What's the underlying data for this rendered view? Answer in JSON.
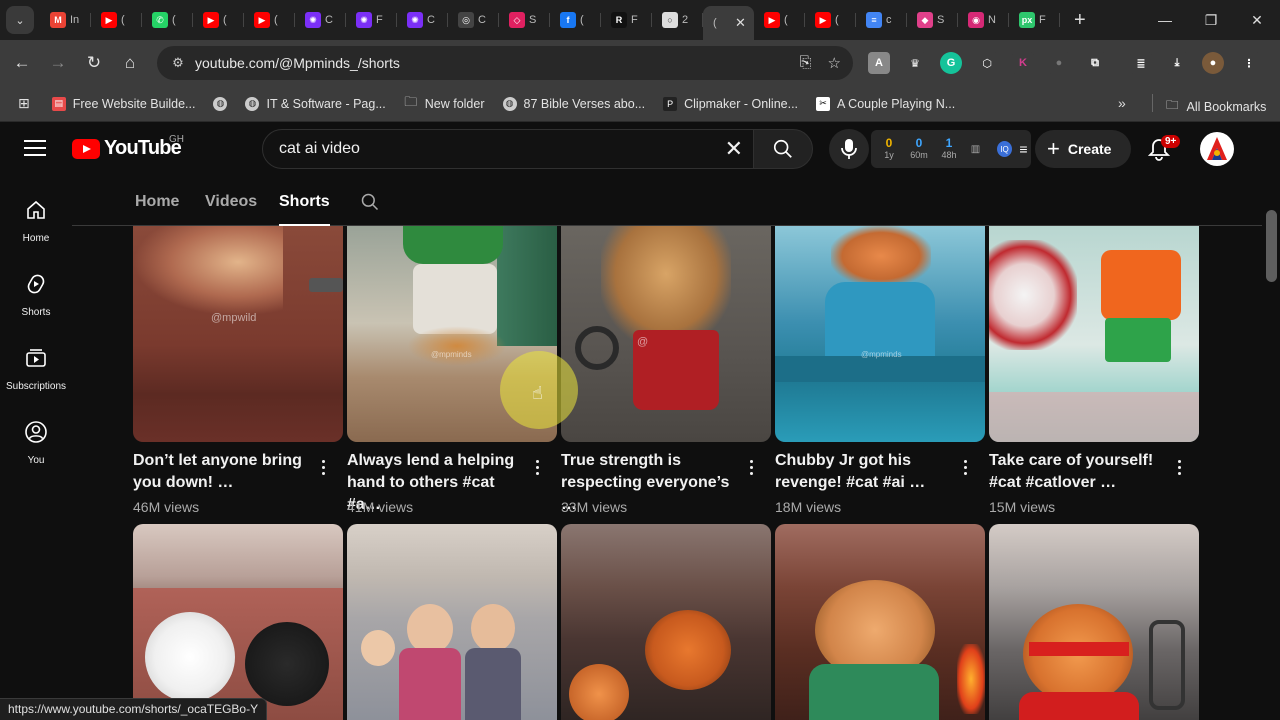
{
  "browser": {
    "tabs": [
      {
        "icon": "tab-list-icon",
        "title": ""
      },
      {
        "icon": "gmail-icon",
        "title": "In",
        "color": "#ea4335",
        "glyph": "M"
      },
      {
        "icon": "youtube-icon",
        "title": "(",
        "color": "#ff0000",
        "glyph": "▶"
      },
      {
        "icon": "whatsapp-icon",
        "title": "(",
        "color": "#25d366",
        "glyph": "✆"
      },
      {
        "icon": "youtube-icon",
        "title": "(",
        "color": "#ff0000",
        "glyph": "▶"
      },
      {
        "icon": "youtube-icon",
        "title": "(",
        "color": "#ff0000",
        "glyph": "▶"
      },
      {
        "icon": "purple-gear-icon",
        "title": "C",
        "color": "#7b2ff7",
        "glyph": "✺"
      },
      {
        "icon": "purple-gear-icon",
        "title": "F",
        "color": "#7b2ff7",
        "glyph": "✺"
      },
      {
        "icon": "purple-gear-icon",
        "title": "C",
        "color": "#7b2ff7",
        "glyph": "✺"
      },
      {
        "icon": "openai-icon",
        "title": "C",
        "color": "#444444",
        "glyph": "◎"
      },
      {
        "icon": "shortcut-icon",
        "title": "S",
        "color": "#e02060",
        "glyph": "◇"
      },
      {
        "icon": "facebook-icon",
        "title": "(",
        "color": "#1877f2",
        "glyph": "f"
      },
      {
        "icon": "r-icon",
        "title": "F",
        "color": "#111111",
        "glyph": "R"
      },
      {
        "icon": "circle-icon",
        "title": "2",
        "color": "#dddddd",
        "glyph": "○"
      },
      {
        "icon": "active-tab",
        "title": "(",
        "color": "#3c3c3c",
        "glyph": ""
      },
      {
        "icon": "youtube-icon",
        "title": "(",
        "color": "#ff0000",
        "glyph": "▶"
      },
      {
        "icon": "youtube-icon",
        "title": "(",
        "color": "#ff0000",
        "glyph": "▶"
      },
      {
        "icon": "docs-icon",
        "title": "c",
        "color": "#4285f4",
        "glyph": "≡"
      },
      {
        "icon": "photo-icon",
        "title": "S",
        "color": "#e0408a",
        "glyph": "◆"
      },
      {
        "icon": "instagram-icon",
        "title": "N",
        "color": "#d62976",
        "glyph": "◉"
      },
      {
        "icon": "pixabay-icon",
        "title": "F",
        "color": "#2ec66d",
        "glyph": "px"
      }
    ],
    "url": "youtube.com/@Mpminds_/shorts",
    "bookmarks": [
      {
        "label": "Free Website Builde...",
        "icon": "page-icon"
      },
      {
        "label": "",
        "icon": "globe-icon"
      },
      {
        "label": "IT & Software - Pag...",
        "icon": "globe-icon"
      },
      {
        "label": "New folder",
        "icon": "folder-icon"
      },
      {
        "label": "87 Bible Verses abo...",
        "icon": "globe-icon"
      },
      {
        "label": "Clipmaker - Online...",
        "icon": "p-icon"
      },
      {
        "label": "A Couple Playing N...",
        "icon": "capcut-icon"
      }
    ],
    "all_bookmarks": "All Bookmarks",
    "status_url": "https://www.youtube.com/shorts/_ocaTEGBo-Y"
  },
  "youtube": {
    "logo_text": "YouTube",
    "country": "GH",
    "search_query": "cat ai video",
    "stats": [
      {
        "value": "0",
        "label": "1y",
        "color": "#f0b400"
      },
      {
        "value": "0",
        "label": "60m",
        "color": "#3ea6ff"
      },
      {
        "value": "1",
        "label": "48h",
        "color": "#3ea6ff"
      }
    ],
    "create_label": "Create",
    "notification_count": "9+",
    "sidebar": [
      {
        "label": "Home",
        "icon": "home-icon"
      },
      {
        "label": "Shorts",
        "icon": "shorts-icon"
      },
      {
        "label": "Subscriptions",
        "icon": "subscriptions-icon"
      },
      {
        "label": "You",
        "icon": "user-icon"
      }
    ],
    "channel_tabs": [
      "Home",
      "Videos",
      "Shorts"
    ],
    "active_tab": "Shorts",
    "row1": [
      {
        "title": "Don’t let anyone bring you down! …",
        "views": "46M views",
        "watermark": "@mpwild"
      },
      {
        "title": "Always lend a helping hand to others #cat #a…",
        "views": "41M views",
        "watermark": "@mpminds"
      },
      {
        "title": "True strength is respecting everyone’s …",
        "views": "33M views",
        "watermark": "@"
      },
      {
        "title": "Chubby Jr got his revenge! #cat #ai …",
        "views": "18M views",
        "watermark": "@mpminds"
      },
      {
        "title": "Take care of yourself! #cat #catlover …",
        "views": "15M views",
        "watermark": ""
      }
    ]
  }
}
